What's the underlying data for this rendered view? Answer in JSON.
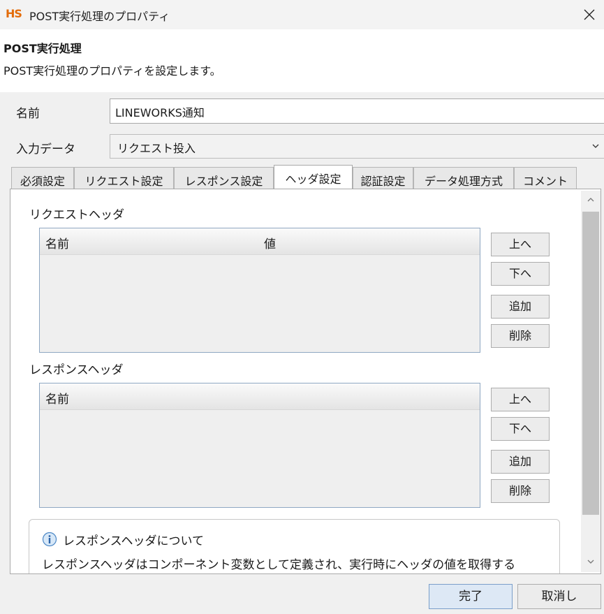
{
  "window": {
    "logo": "HS",
    "title": "POST実行処理のプロパティ",
    "close_icon": "close-icon"
  },
  "header": {
    "title": "POST実行処理",
    "description": "POST実行処理のプロパティを設定します。"
  },
  "form": {
    "name_label": "名前",
    "name_value": "LINEWORKS通知",
    "input_label": "入力データ",
    "input_value": "リクエスト投入"
  },
  "tabs": [
    {
      "label": "必須設定"
    },
    {
      "label": "リクエスト設定"
    },
    {
      "label": "レスポンス設定"
    },
    {
      "label": "ヘッダ設定"
    },
    {
      "label": "認証設定"
    },
    {
      "label": "データ処理方式"
    },
    {
      "label": "コメント"
    }
  ],
  "active_tab": "ヘッダ設定",
  "request_headers": {
    "label": "リクエストヘッダ",
    "columns": [
      "名前",
      "値"
    ],
    "rows": [],
    "buttons": {
      "up": "上へ",
      "down": "下へ",
      "add": "追加",
      "delete": "削除"
    }
  },
  "response_headers": {
    "label": "レスポンスヘッダ",
    "columns": [
      "名前"
    ],
    "rows": [],
    "buttons": {
      "up": "上へ",
      "down": "下へ",
      "add": "追加",
      "delete": "削除"
    }
  },
  "info": {
    "icon": "info-icon",
    "title": "レスポンスヘッダについて",
    "text": "レスポンスヘッダはコンポーネント変数として定義され、実行時にヘッダの値を取得する"
  },
  "footer": {
    "ok": "完了",
    "cancel": "取消し"
  },
  "colors": {
    "logo": "#e36c0a",
    "ok_button_bg": "#dde8f5",
    "table_border": "#8fa7c2"
  }
}
